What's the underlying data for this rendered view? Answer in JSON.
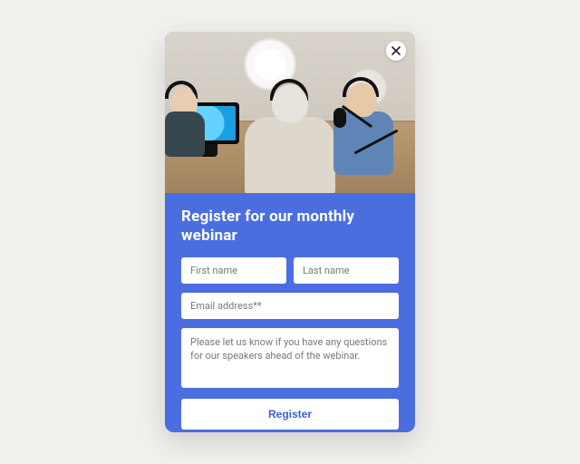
{
  "modal": {
    "title": "Register for our monthly webinar",
    "close_icon_name": "close-icon"
  },
  "form": {
    "first_name_placeholder": "First name",
    "last_name_placeholder": "Last name",
    "email_placeholder": "Email address**",
    "message_placeholder": "Please let us know if you have any questions for our speakers ahead of the webinar.",
    "submit_label": "Register"
  },
  "colors": {
    "panel": "#4a6ee0",
    "page_bg": "#f1f0ec",
    "submit_text": "#3a5ed1"
  }
}
